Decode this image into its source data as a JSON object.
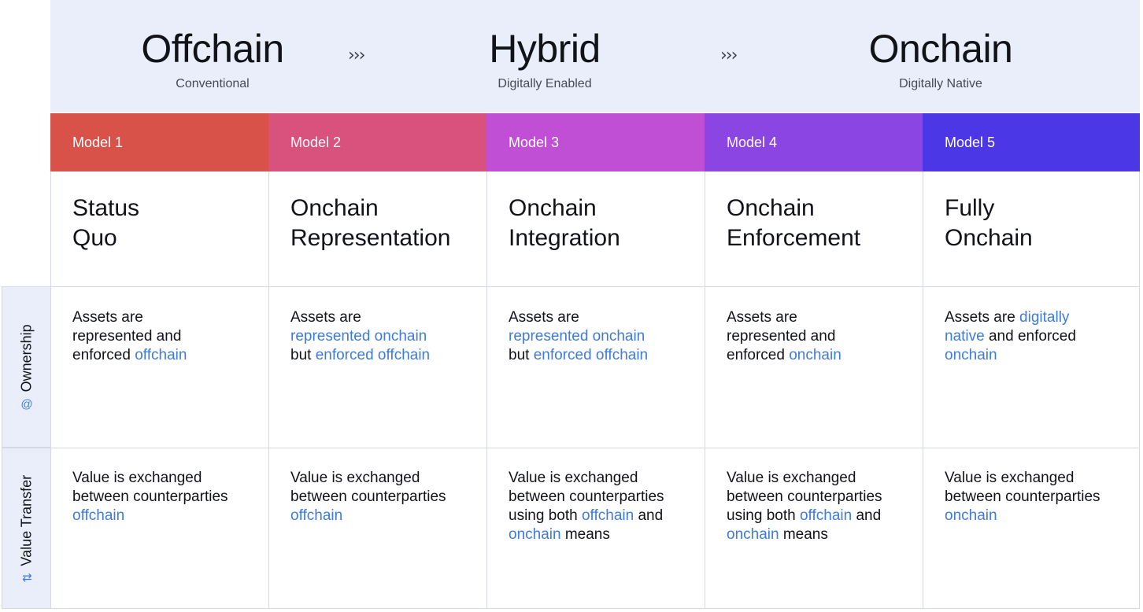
{
  "stages": [
    {
      "title": "Offchain",
      "subtitle": "Conventional"
    },
    {
      "title": "Hybrid",
      "subtitle": "Digitally Enabled"
    },
    {
      "title": "Onchain",
      "subtitle": "Digitally Native"
    }
  ],
  "chevrons": "›››",
  "colors": {
    "model1": "#d9524a",
    "model2": "#d9527d",
    "model3": "#c04fd6",
    "model4": "#8a45e3",
    "model5": "#4b37e6",
    "highlight": "#3e7bdc",
    "header_bg": "#e9eefa"
  },
  "models": [
    {
      "label": "Model 1",
      "title_line1": "Status",
      "title_line2": "Quo"
    },
    {
      "label": "Model 2",
      "title_line1": "Onchain",
      "title_line2": "Representation"
    },
    {
      "label": "Model 3",
      "title_line1": "Onchain",
      "title_line2": "Integration"
    },
    {
      "label": "Model 4",
      "title_line1": "Onchain",
      "title_line2": "Enforcement"
    },
    {
      "label": "Model 5",
      "title_line1": "Fully",
      "title_line2": "Onchain"
    }
  ],
  "rows": {
    "ownership": {
      "label": "Ownership",
      "icon": "at-sign-icon",
      "cells": [
        [
          [
            "Assets are",
            false
          ],
          [
            "\n",
            false
          ],
          [
            "represented and",
            false
          ],
          [
            "\n",
            false
          ],
          [
            "enforced ",
            false
          ],
          [
            "offchain",
            true
          ]
        ],
        [
          [
            "Assets are",
            false
          ],
          [
            "\n",
            false
          ],
          [
            "represented onchain",
            true
          ],
          [
            "\n",
            false
          ],
          [
            "but ",
            false
          ],
          [
            "enforced offchain",
            true
          ]
        ],
        [
          [
            "Assets are",
            false
          ],
          [
            "\n",
            false
          ],
          [
            "represented onchain",
            true
          ],
          [
            "\n",
            false
          ],
          [
            "but ",
            false
          ],
          [
            "enforced offchain",
            true
          ]
        ],
        [
          [
            "Assets are",
            false
          ],
          [
            "\n",
            false
          ],
          [
            "represented and",
            false
          ],
          [
            "\n",
            false
          ],
          [
            "enforced ",
            false
          ],
          [
            "onchain",
            true
          ]
        ],
        [
          [
            "Assets are ",
            false
          ],
          [
            "digitally",
            true
          ],
          [
            "\n",
            false
          ],
          [
            "native",
            true
          ],
          [
            " and enforced",
            false
          ],
          [
            "\n",
            false
          ],
          [
            "onchain",
            true
          ]
        ]
      ]
    },
    "value_transfer": {
      "label": "Value Transfer",
      "icon": "arrows-exchange-icon",
      "cells": [
        [
          [
            "Value is exchanged",
            false
          ],
          [
            "\n",
            false
          ],
          [
            "between counterparties",
            false
          ],
          [
            "\n",
            false
          ],
          [
            "offchain",
            true
          ]
        ],
        [
          [
            "Value is exchanged",
            false
          ],
          [
            "\n",
            false
          ],
          [
            "between counterparties",
            false
          ],
          [
            "\n",
            false
          ],
          [
            "offchain",
            true
          ]
        ],
        [
          [
            "Value is exchanged",
            false
          ],
          [
            "\n",
            false
          ],
          [
            "between counterparties",
            false
          ],
          [
            "\n",
            false
          ],
          [
            "using both ",
            false
          ],
          [
            "offchain",
            true
          ],
          [
            " and",
            false
          ],
          [
            "\n",
            false
          ],
          [
            "onchain",
            true
          ],
          [
            " means",
            false
          ]
        ],
        [
          [
            "Value is exchanged",
            false
          ],
          [
            "\n",
            false
          ],
          [
            "between counterparties",
            false
          ],
          [
            "\n",
            false
          ],
          [
            "using both ",
            false
          ],
          [
            "offchain",
            true
          ],
          [
            " and",
            false
          ],
          [
            "\n",
            false
          ],
          [
            "onchain",
            true
          ],
          [
            " means",
            false
          ]
        ],
        [
          [
            "Value is exchanged",
            false
          ],
          [
            "\n",
            false
          ],
          [
            "between counterparties",
            false
          ],
          [
            "\n",
            false
          ],
          [
            "onchain",
            true
          ]
        ]
      ]
    }
  }
}
